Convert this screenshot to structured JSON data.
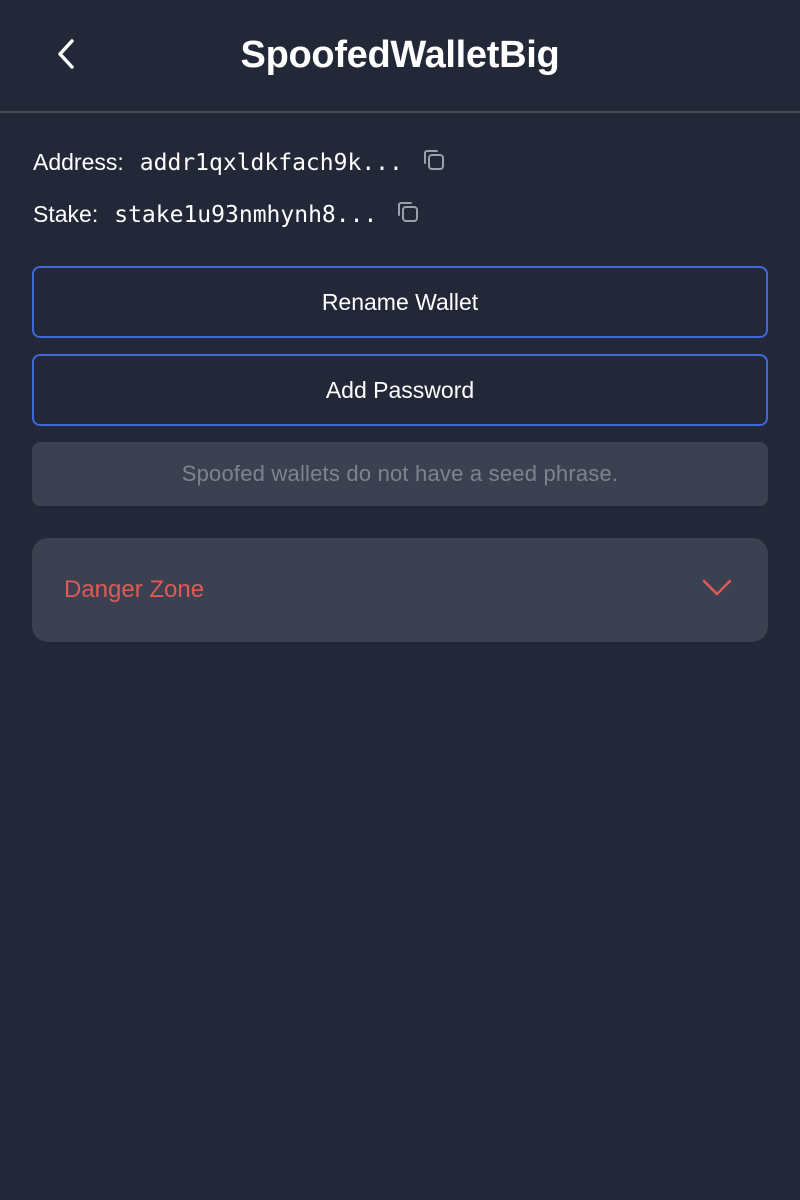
{
  "header": {
    "title": "SpoofedWalletBig",
    "back_icon": "chevron-left-icon"
  },
  "wallet": {
    "address_label": "Address:",
    "address_value": "addr1qxldkfach9k...",
    "stake_label": "Stake:",
    "stake_value": "stake1u93nmhynh8...",
    "copy_icon": "copy-icon"
  },
  "actions": {
    "rename_label": "Rename Wallet",
    "add_password_label": "Add Password"
  },
  "notice": {
    "text": "Spoofed wallets do not have a seed phrase."
  },
  "danger_zone": {
    "label": "Danger Zone",
    "icon": "chevron-down-icon"
  },
  "colors": {
    "background": "#222837",
    "accent_border": "#3f67d9",
    "danger": "#e05a55",
    "panel": "#3b4150",
    "muted_text": "#7d8391"
  }
}
